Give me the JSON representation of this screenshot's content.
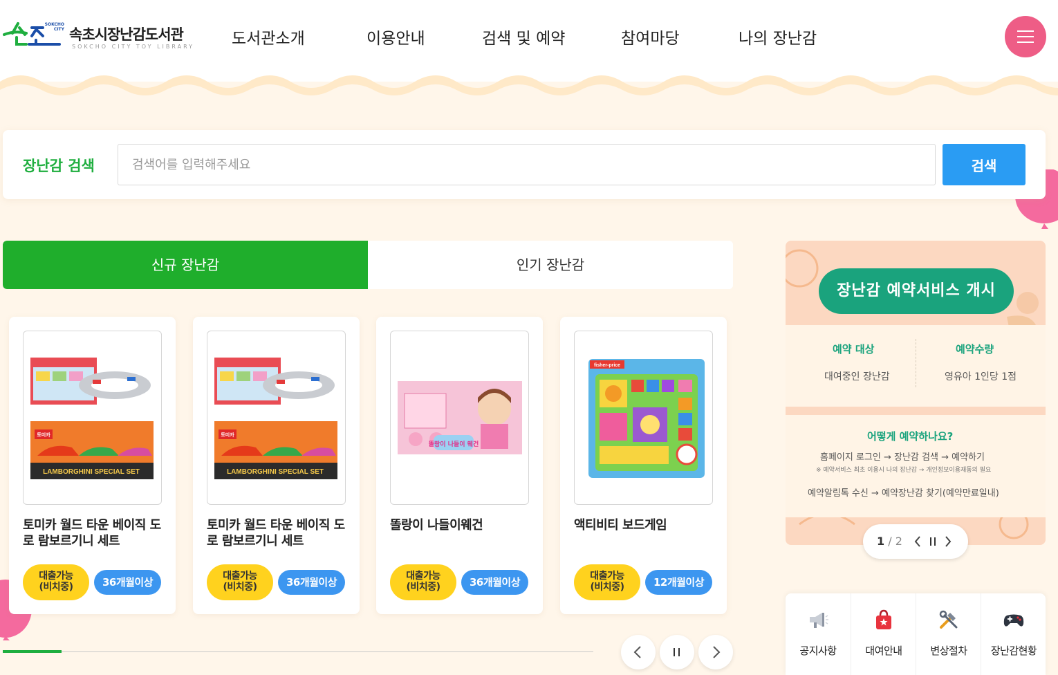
{
  "colors": {
    "brand_green": "#1fae3f",
    "search_blue": "#2a9cf3",
    "menu_pink": "#ee5d86",
    "badge_yellow": "#ffd21e",
    "badge_blue": "#3c96f0",
    "banner_teal": "#1aa37d"
  },
  "header": {
    "logo_text": "속초시장난감도서관",
    "logo_en": "SOKCHO CITY TOY LIBRARY",
    "logo_city": "SOKCHO CITY",
    "nav": [
      "도서관소개",
      "이용안내",
      "검색 및 예약",
      "참여마당",
      "나의 장난감"
    ],
    "menu_icon": "hamburger-icon"
  },
  "search": {
    "label": "장난감 검색",
    "placeholder": "검색어를 입력해주세요",
    "value": "",
    "button": "검색"
  },
  "tabs": [
    {
      "label": "신규 장난감",
      "active": true
    },
    {
      "label": "인기 장난감",
      "active": false
    }
  ],
  "toys": [
    {
      "title": "토미카 월드 타운 베이직 도로 람보르기니 세트",
      "status": "대출가능\n(비치중)",
      "age": "36개월이상",
      "image_caption": "LAMBORGHINI SPECIAL SET",
      "box_label": "토미카"
    },
    {
      "title": "토미카 월드 타운 베이직 도로 람보르기니 세트",
      "status": "대출가능\n(비치중)",
      "age": "36개월이상",
      "image_caption": "LAMBORGHINI SPECIAL SET",
      "box_label": "토미카"
    },
    {
      "title": "똘랑이 나들이웨건",
      "status": "대출가능\n(비치중)",
      "age": "36개월이상",
      "image_caption": "똘랑이 나들이 웨건"
    },
    {
      "title": "액티비티 보드게임",
      "status": "대출가능\n(비치중)",
      "age": "12개월이상",
      "image_caption": "fisher-price"
    }
  ],
  "slider": {
    "progress_fraction": 0.1,
    "prev_icon": "chevron-left-icon",
    "pause_icon": "pause-icon",
    "next_icon": "chevron-right-icon"
  },
  "banner": {
    "title": "장난감 예약서비스 개시",
    "target_head": "예약 대상",
    "target_text": "대여중인 장난감",
    "limit_head": "예약수량",
    "limit_text": "영유아 1인당 1점",
    "how_head": "어떻게 예약하나요?",
    "step1": "홈페이지 로그인 → 장난감 검색 → 예약하기",
    "step1_note": "※ 예약서비스 최초 이용시 나의 장난감 → 개인정보이용재동의 필요",
    "step2": "예약알림톡 수신 → 예약장난감 찾기(예약만료일내)",
    "pager_current": "1",
    "pager_total": "/ 2"
  },
  "quick_menu": [
    {
      "label": "공지사항",
      "icon": "megaphone-icon"
    },
    {
      "label": "대여안내",
      "icon": "shopping-bag-icon"
    },
    {
      "label": "변상절차",
      "icon": "tools-icon"
    },
    {
      "label": "장난감현황",
      "icon": "gamepad-icon"
    }
  ]
}
